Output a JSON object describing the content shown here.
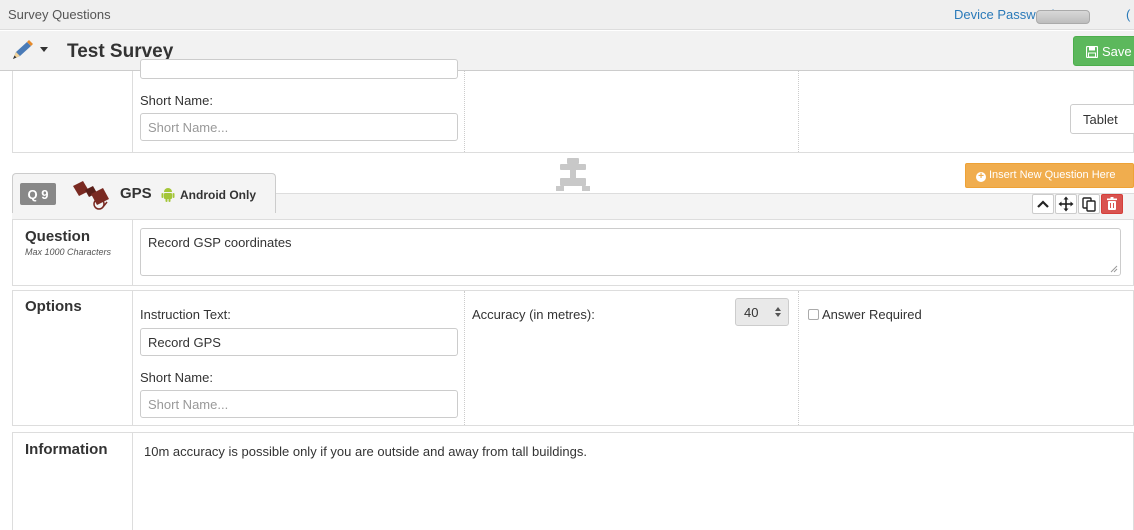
{
  "topbar": {
    "breadcrumb": "Survey Questions",
    "device_password_label": "Device Password:",
    "edge_glyph": "("
  },
  "header": {
    "title": "Test Survey",
    "save_label": "Save",
    "pencil_icon": "pencil-icon"
  },
  "prev_question": {
    "short_name_label": "Short Name:",
    "short_name_placeholder": "Short Name...",
    "tablet_label": "Tablet"
  },
  "question": {
    "number": "Q 9",
    "type_label": "GPS",
    "platform_label": "Android Only",
    "insert_label": "Insert New Question Here",
    "question_heading": "Question",
    "question_subheading": "Max 1000 Characters",
    "question_text": "Record GSP coordinates",
    "options_heading": "Options",
    "instruction_label": "Instruction Text:",
    "instruction_value": "Record GPS",
    "short_name_label": "Short Name:",
    "short_name_placeholder": "Short Name...",
    "accuracy_label": "Accuracy (in metres):",
    "accuracy_value": "40",
    "answer_required_label": "Answer Required",
    "answer_required_checked": false,
    "information_heading": "Information",
    "information_text": "10m accuracy is possible only if you are outside and away from tall buildings."
  },
  "colors": {
    "save_green": "#5cb85c",
    "insert_orange": "#f0ad4e",
    "delete_red": "#d9534f",
    "link_blue": "#2a7ab9",
    "android_green": "#a4c639"
  }
}
